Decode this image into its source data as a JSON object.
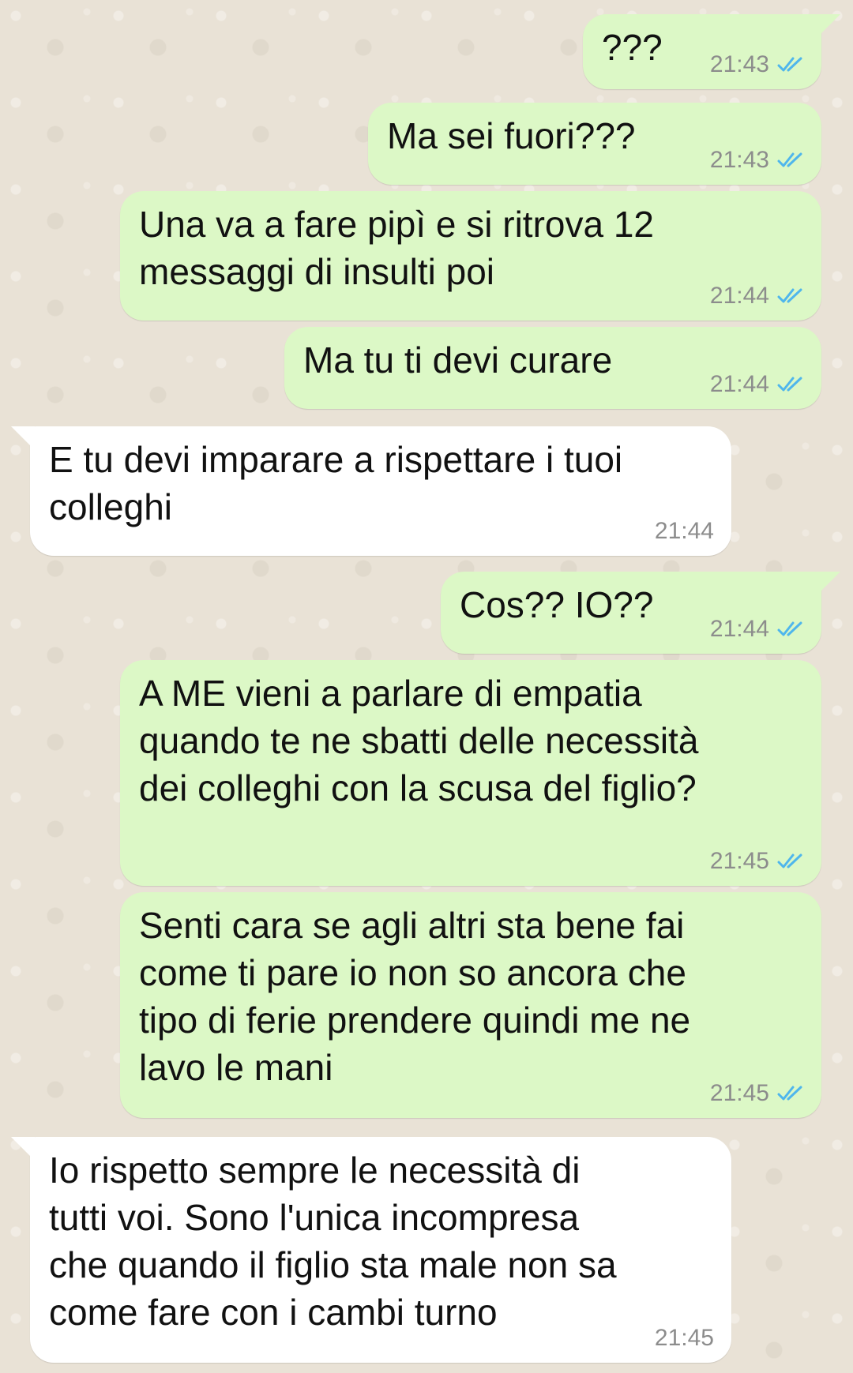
{
  "messages": [
    {
      "direction": "out",
      "text": "???",
      "time": "21:43",
      "status": "read"
    },
    {
      "direction": "out",
      "text": "Ma sei fuori???",
      "time": "21:43",
      "status": "read"
    },
    {
      "direction": "out",
      "text": "Una va a fare pipì e si ritrova 12\nmessaggi di insulti poi",
      "time": "21:44",
      "status": "read"
    },
    {
      "direction": "out",
      "text": "Ma tu ti devi curare",
      "time": "21:44",
      "status": "read"
    },
    {
      "direction": "in",
      "text": "E tu devi imparare a rispettare i tuoi\ncolleghi",
      "time": "21:44"
    },
    {
      "direction": "out",
      "text": "Cos?? IO??",
      "time": "21:44",
      "status": "read"
    },
    {
      "direction": "out",
      "text": "A ME vieni a parlare di empatia\nquando te ne sbatti delle necessità\ndei colleghi con la scusa del figlio?",
      "time": "21:45",
      "status": "read"
    },
    {
      "direction": "out",
      "text": "Senti cara se agli altri sta bene fai\ncome ti pare io non so ancora che\ntipo di ferie prendere quindi me ne\nlavo le mani",
      "time": "21:45",
      "status": "read"
    },
    {
      "direction": "in",
      "text": "Io rispetto sempre le necessità di\ntutti voi. Sono l'unica incompresa\nche quando il figlio sta male non sa\ncome fare con i cambi turno",
      "time": "21:45"
    }
  ],
  "colors": {
    "outgoing_bubble": "#dcf8c6",
    "incoming_bubble": "#ffffff",
    "read_ticks": "#4fb6ec",
    "timestamp": "#8c8c8c",
    "wallpaper": "#e9e2d6"
  },
  "icons": {
    "read_status": "double-check-icon"
  }
}
